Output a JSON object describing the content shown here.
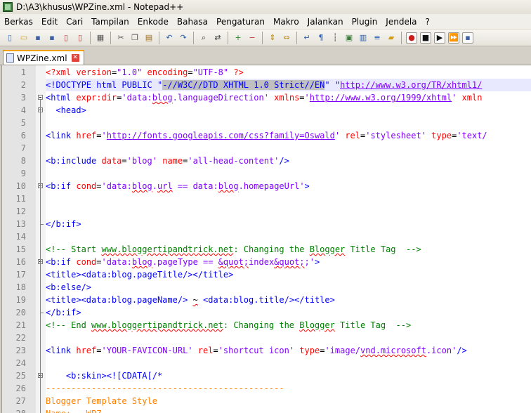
{
  "window": {
    "title": "D:\\A3\\khusus\\WPZine.xml - Notepad++",
    "icon": "notepadpp-icon"
  },
  "menu": [
    "Berkas",
    "Edit",
    "Cari",
    "Tampilan",
    "Enkode",
    "Bahasa",
    "Pengaturan",
    "Makro",
    "Jalankan",
    "Plugin",
    "Jendela",
    "?"
  ],
  "toolbar": {
    "buttons": [
      "new-file-icon",
      "open-file-icon",
      "save-icon",
      "save-all-icon",
      "close-icon",
      "close-all-icon",
      "print-icon",
      "cut-icon",
      "copy-icon",
      "paste-icon",
      "undo-icon",
      "redo-icon",
      "find-icon",
      "replace-icon",
      "zoom-in-icon",
      "zoom-out-icon",
      "sync-vertical-icon",
      "sync-horizontal-icon",
      "word-wrap-icon",
      "show-all-chars-icon",
      "indent-guide-icon",
      "user-lang-icon",
      "doc-map-icon",
      "function-list-icon",
      "folder-icon",
      "record-macro-icon",
      "stop-record-icon",
      "play-macro-icon",
      "run-macro-multiple-icon",
      "save-macro-icon"
    ]
  },
  "tab": {
    "label": "WPZine.xml",
    "close_icon": "close-tab-icon"
  },
  "lines": [
    {
      "n": "1",
      "segs": [
        [
          "pi",
          "<?xml "
        ],
        [
          "attr",
          "version"
        ],
        [
          "txt",
          "="
        ],
        [
          "str",
          "\"1.0\""
        ],
        [
          "txt",
          " "
        ],
        [
          "attr",
          "encoding"
        ],
        [
          "txt",
          "="
        ],
        [
          "str",
          "\"UTF-8\""
        ],
        [
          "pi",
          " ?>"
        ]
      ]
    },
    {
      "n": "2",
      "segs": [
        [
          "tag",
          "<"
        ],
        [
          "tag",
          "!DOCTYPE html PUBLIC \""
        ],
        [
          "selsp",
          "-//W3C//DTD XHTML 1.0 Strict//EN"
        ],
        [
          "tag",
          "\" \""
        ],
        [
          "url",
          "http://www.w3.org/TR/xhtml1/"
        ]
      ]
    },
    {
      "n": "3",
      "segs": [
        [
          "tag",
          "<html "
        ],
        [
          "attr",
          "expr:dir"
        ],
        [
          "txt",
          "="
        ],
        [
          "str",
          "'data:"
        ],
        [
          "strsp",
          "blog"
        ],
        [
          "str",
          ".languageDirection'"
        ],
        [
          "txt",
          " "
        ],
        [
          "attr",
          "xmlns"
        ],
        [
          "txt",
          "="
        ],
        [
          "str",
          "'"
        ],
        [
          "url",
          "http://www.w3.org/1999/xhtml"
        ],
        [
          "str",
          "'"
        ],
        [
          "txt",
          " "
        ],
        [
          "attr",
          "xmln"
        ]
      ]
    },
    {
      "n": "4",
      "segs": [
        [
          "txt",
          "  "
        ],
        [
          "tag",
          "<head>"
        ]
      ]
    },
    {
      "n": "5",
      "segs": []
    },
    {
      "n": "6",
      "segs": [
        [
          "tag",
          "<link "
        ],
        [
          "attr",
          "href"
        ],
        [
          "txt",
          "="
        ],
        [
          "str",
          "'"
        ],
        [
          "url",
          "http://fonts.googleapis.com/css?family=Oswald"
        ],
        [
          "str",
          "'"
        ],
        [
          "txt",
          " "
        ],
        [
          "attr",
          "rel"
        ],
        [
          "txt",
          "="
        ],
        [
          "str",
          "'stylesheet'"
        ],
        [
          "txt",
          " "
        ],
        [
          "attr",
          "type"
        ],
        [
          "txt",
          "="
        ],
        [
          "str",
          "'text/"
        ]
      ]
    },
    {
      "n": "7",
      "segs": []
    },
    {
      "n": "8",
      "segs": [
        [
          "tag",
          "<b:include "
        ],
        [
          "attr",
          "data"
        ],
        [
          "txt",
          "="
        ],
        [
          "str",
          "'blog'"
        ],
        [
          "txt",
          " "
        ],
        [
          "attr",
          "name"
        ],
        [
          "txt",
          "="
        ],
        [
          "str",
          "'all-head-content'"
        ],
        [
          "tag",
          "/>"
        ]
      ]
    },
    {
      "n": "9",
      "segs": []
    },
    {
      "n": "10",
      "segs": [
        [
          "tag",
          "<b:if "
        ],
        [
          "attr",
          "cond"
        ],
        [
          "txt",
          "="
        ],
        [
          "str",
          "'data:"
        ],
        [
          "strsp",
          "blog"
        ],
        [
          "str",
          "."
        ],
        [
          "strsp",
          "url"
        ],
        [
          "str",
          " == data:"
        ],
        [
          "strsp",
          "blog"
        ],
        [
          "str",
          ".homepageUrl'"
        ],
        [
          "tag",
          ">"
        ]
      ]
    },
    {
      "n": "11",
      "segs": []
    },
    {
      "n": "12",
      "segs": []
    },
    {
      "n": "13",
      "segs": [
        [
          "tag",
          "</b:if>"
        ]
      ]
    },
    {
      "n": "14",
      "segs": []
    },
    {
      "n": "15",
      "segs": [
        [
          "com",
          "<!-- Start "
        ],
        [
          "comsp",
          "www.bloggertipandtrick.net"
        ],
        [
          "com",
          ": Changing the "
        ],
        [
          "comsp",
          "Blogger"
        ],
        [
          "com",
          " Title Tag  -->"
        ]
      ]
    },
    {
      "n": "16",
      "segs": [
        [
          "tag",
          "<b:if "
        ],
        [
          "attr",
          "cond"
        ],
        [
          "txt",
          "="
        ],
        [
          "str",
          "'data:"
        ],
        [
          "strsp",
          "blog"
        ],
        [
          "str",
          ".pageType == "
        ],
        [
          "strsp",
          "&quot;"
        ],
        [
          "str",
          "index"
        ],
        [
          "strsp",
          "&quot;"
        ],
        [
          "str",
          ";'"
        ],
        [
          "tag",
          ">"
        ]
      ]
    },
    {
      "n": "17",
      "segs": [
        [
          "tag",
          "<title>"
        ],
        [
          "tag",
          "<data:blog.pageTitle/>"
        ],
        [
          "tag",
          "</title>"
        ]
      ]
    },
    {
      "n": "18",
      "segs": [
        [
          "tag",
          "<b:else/>"
        ]
      ]
    },
    {
      "n": "19",
      "segs": [
        [
          "tag",
          "<title>"
        ],
        [
          "tag",
          "<data:blog.pageName/>"
        ],
        [
          "txt",
          " "
        ],
        [
          "txtsp",
          "~"
        ],
        [
          "txt",
          " "
        ],
        [
          "tag",
          "<data:blog.title/>"
        ],
        [
          "tag",
          "</title>"
        ]
      ]
    },
    {
      "n": "20",
      "segs": [
        [
          "tag",
          "</b:if>"
        ]
      ]
    },
    {
      "n": "21",
      "segs": [
        [
          "com",
          "<!-- End "
        ],
        [
          "comsp",
          "www.bloggertipandtrick.net"
        ],
        [
          "com",
          ": Changing the "
        ],
        [
          "comsp",
          "Blogger"
        ],
        [
          "com",
          " Title Tag  -->"
        ]
      ]
    },
    {
      "n": "22",
      "segs": []
    },
    {
      "n": "23",
      "segs": [
        [
          "tag",
          "<link "
        ],
        [
          "attr",
          "href"
        ],
        [
          "txt",
          "="
        ],
        [
          "str",
          "'YOUR-FAVICON-URL'"
        ],
        [
          "txt",
          " "
        ],
        [
          "attr",
          "rel"
        ],
        [
          "txt",
          "="
        ],
        [
          "str",
          "'shortcut icon'"
        ],
        [
          "txt",
          " "
        ],
        [
          "attr",
          "type"
        ],
        [
          "txt",
          "="
        ],
        [
          "str",
          "'image/"
        ],
        [
          "strsp",
          "vnd.microsoft"
        ],
        [
          "str",
          ".icon'"
        ],
        [
          "tag",
          "/>"
        ]
      ]
    },
    {
      "n": "24",
      "segs": []
    },
    {
      "n": "25",
      "segs": [
        [
          "txt",
          "    "
        ],
        [
          "tag",
          "<b:skin>"
        ],
        [
          "tag",
          "<![CDATA[/*"
        ]
      ]
    },
    {
      "n": "26",
      "segs": [
        [
          "css",
          "-----------------------------------------------"
        ]
      ]
    },
    {
      "n": "27",
      "segs": [
        [
          "css",
          "Blogger Template Style"
        ]
      ]
    },
    {
      "n": "28",
      "segs": [
        [
          "css",
          "Name:   WPZ"
        ]
      ]
    }
  ]
}
